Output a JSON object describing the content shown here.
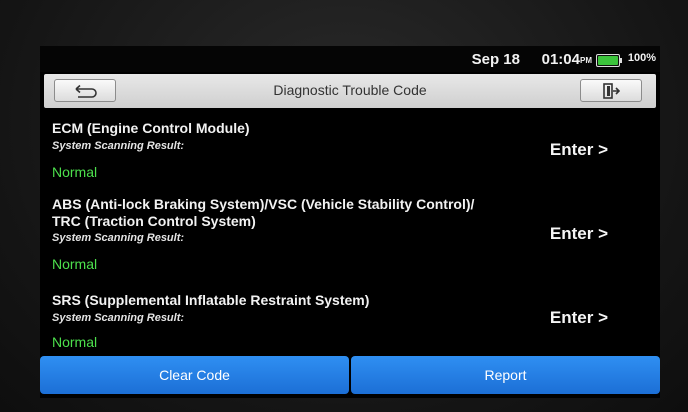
{
  "status_bar": {
    "date": "Sep 18",
    "time": "01:04",
    "ampm": "PM",
    "battery_percent": "100%",
    "battery_level": 1.0,
    "battery_color": "#3cc43c"
  },
  "header": {
    "title": "Diagnostic Trouble Code",
    "back_icon": "back-arrow-icon",
    "exit_icon": "exit-door-icon"
  },
  "modules": [
    {
      "name_lines": [
        "ECM (Engine Control Module)"
      ],
      "scan_label": "System Scanning Result:",
      "result": "Normal",
      "action_label": "Enter >"
    },
    {
      "name_lines": [
        "ABS (Anti-lock Braking System)/VSC (Vehicle Stability Control)/",
        "TRC (Traction Control System)"
      ],
      "scan_label": "System Scanning Result:",
      "result": "Normal",
      "action_label": "Enter >"
    },
    {
      "name_lines": [
        "SRS (Supplemental Inflatable Restraint System)"
      ],
      "scan_label": "System Scanning Result:",
      "result": "Normal",
      "action_label": "Enter >"
    }
  ],
  "footer": {
    "clear_code_label": "Clear Code",
    "report_label": "Report"
  },
  "colors": {
    "result_normal": "#4de04d",
    "button_blue": "#1c6fd6",
    "title_bar": "#d8d8d8"
  }
}
